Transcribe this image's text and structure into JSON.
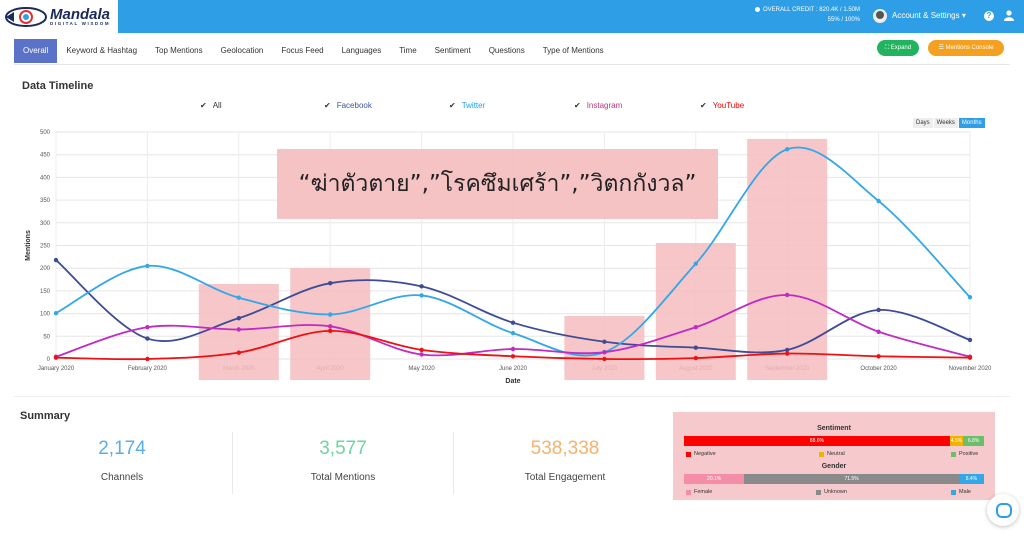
{
  "header": {
    "logo_title": "Mandala",
    "logo_sub": "DIGITAL WISDOM",
    "credit_label": "OVERALL CREDIT : 820.4K / 1.50M",
    "credit_percent": "55% / 100%",
    "account_label": "Account & Settings ▾",
    "help_label": "?"
  },
  "tabs": [
    "Overall",
    "Keyword & Hashtag",
    "Top Mentions",
    "Geolocation",
    "Focus Feed",
    "Languages",
    "Time",
    "Sentiment",
    "Questions",
    "Type of Mentions"
  ],
  "buttons": {
    "expand": "⛶ Expand",
    "console": "☰ Mentions Console"
  },
  "timeline": {
    "title": "Data Timeline",
    "legend": [
      {
        "label": "All",
        "color": "#333333"
      },
      {
        "label": "Facebook",
        "color": "#3b5998"
      },
      {
        "label": "Twitter",
        "color": "#1da1f2"
      },
      {
        "label": "Instagram",
        "color": "#c13584"
      },
      {
        "label": "YouTube",
        "color": "#ff0000"
      }
    ],
    "ranges": [
      "Days",
      "Weeks",
      "Months"
    ],
    "overlay_text": "“ฆ่าตัวตาย”,”โรคซึมเศร้า”,”วิตกกังวล”"
  },
  "chart_data": {
    "type": "line",
    "x": [
      "January 2020",
      "February 2020",
      "March 2020",
      "April 2020",
      "May 2020",
      "June 2020",
      "July 2020",
      "August 2020",
      "September 2020",
      "October 2020",
      "November 2020"
    ],
    "xlabel": "Date",
    "ylabel": "Mentions",
    "ylim": [
      0,
      500
    ],
    "yticks": [
      0,
      50,
      100,
      150,
      200,
      250,
      300,
      350,
      400,
      450,
      500
    ],
    "grid": true,
    "highlight_months": [
      "March 2020",
      "April 2020",
      "July 2020",
      "August 2020",
      "September 2020"
    ],
    "series": [
      {
        "name": "Facebook",
        "color": "#3f4b96",
        "values": [
          218,
          45,
          90,
          167,
          160,
          80,
          38,
          25,
          20,
          108,
          42
        ]
      },
      {
        "name": "Twitter",
        "color": "#33a7e8",
        "values": [
          101,
          205,
          135,
          98,
          140,
          57,
          15,
          210,
          462,
          348,
          136
        ]
      },
      {
        "name": "Instagram",
        "color": "#c02bc4",
        "values": [
          5,
          70,
          65,
          72,
          10,
          22,
          15,
          70,
          141,
          60,
          5
        ]
      },
      {
        "name": "YouTube",
        "color": "#ee1111",
        "values": [
          3,
          0,
          14,
          62,
          20,
          6,
          0,
          2,
          12,
          6,
          3
        ]
      }
    ]
  },
  "summary": {
    "title": "Summary",
    "stats": [
      {
        "value": "2,174",
        "label": "Channels",
        "color": "#5aaee8"
      },
      {
        "value": "3,577",
        "label": "Total Mentions",
        "color": "#6dd6a0"
      },
      {
        "value": "538,338",
        "label": "Total Engagement",
        "color": "#f6b26b"
      }
    ]
  },
  "sentiment": {
    "title": "Sentiment",
    "segments": [
      {
        "label": "Negative",
        "value": "88.6%",
        "fraction": 0.886,
        "color": "#ff0000"
      },
      {
        "label": "Neutral",
        "value": "4.5%",
        "fraction": 0.045,
        "color": "#f0b400"
      },
      {
        "label": "Positive",
        "value": "6.8%",
        "fraction": 0.069,
        "color": "#6abf69"
      }
    ]
  },
  "gender": {
    "title": "Gender",
    "segments": [
      {
        "label": "Female",
        "value": "20.1%",
        "fraction": 0.201,
        "color": "#f48ea8"
      },
      {
        "label": "Unknown",
        "value": "71.5%",
        "fraction": 0.715,
        "color": "#8a8a8a"
      },
      {
        "label": "Male",
        "value": "8.4%",
        "fraction": 0.084,
        "color": "#33a7e8"
      }
    ]
  }
}
